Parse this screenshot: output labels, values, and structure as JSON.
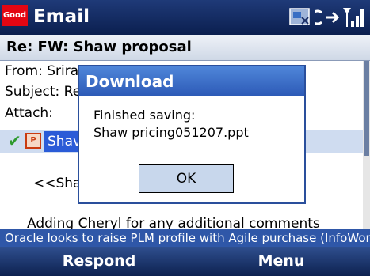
{
  "titlebar": {
    "logo_text": "Good",
    "title": "Email",
    "icons": [
      "sync-icon",
      "connection-icon",
      "signal-icon"
    ]
  },
  "message": {
    "subject_header": "Re: FW: Shaw proposal",
    "from_label": "From: Srira",
    "subject_label": "Subject: Re",
    "attach_label": "Attach:",
    "attachment_name": "Shav",
    "body_line1": "<<Shav",
    "body_line2": "Adding Cheryl for any additional comments"
  },
  "dialog": {
    "title": "Download",
    "line1": "Finished saving:",
    "line2": "Shaw pricing051207.ppt",
    "ok_label": "OK"
  },
  "ticker": {
    "text": "Oracle looks to raise PLM profile with Agile purchase (InfoWor..."
  },
  "softkeys": {
    "left": "Respond",
    "right": "Menu"
  },
  "colors": {
    "titlebar": "#0b1f4f",
    "accent": "#2a5bd7",
    "dialog_title": "#2c59b6",
    "logo": "#e30613"
  }
}
